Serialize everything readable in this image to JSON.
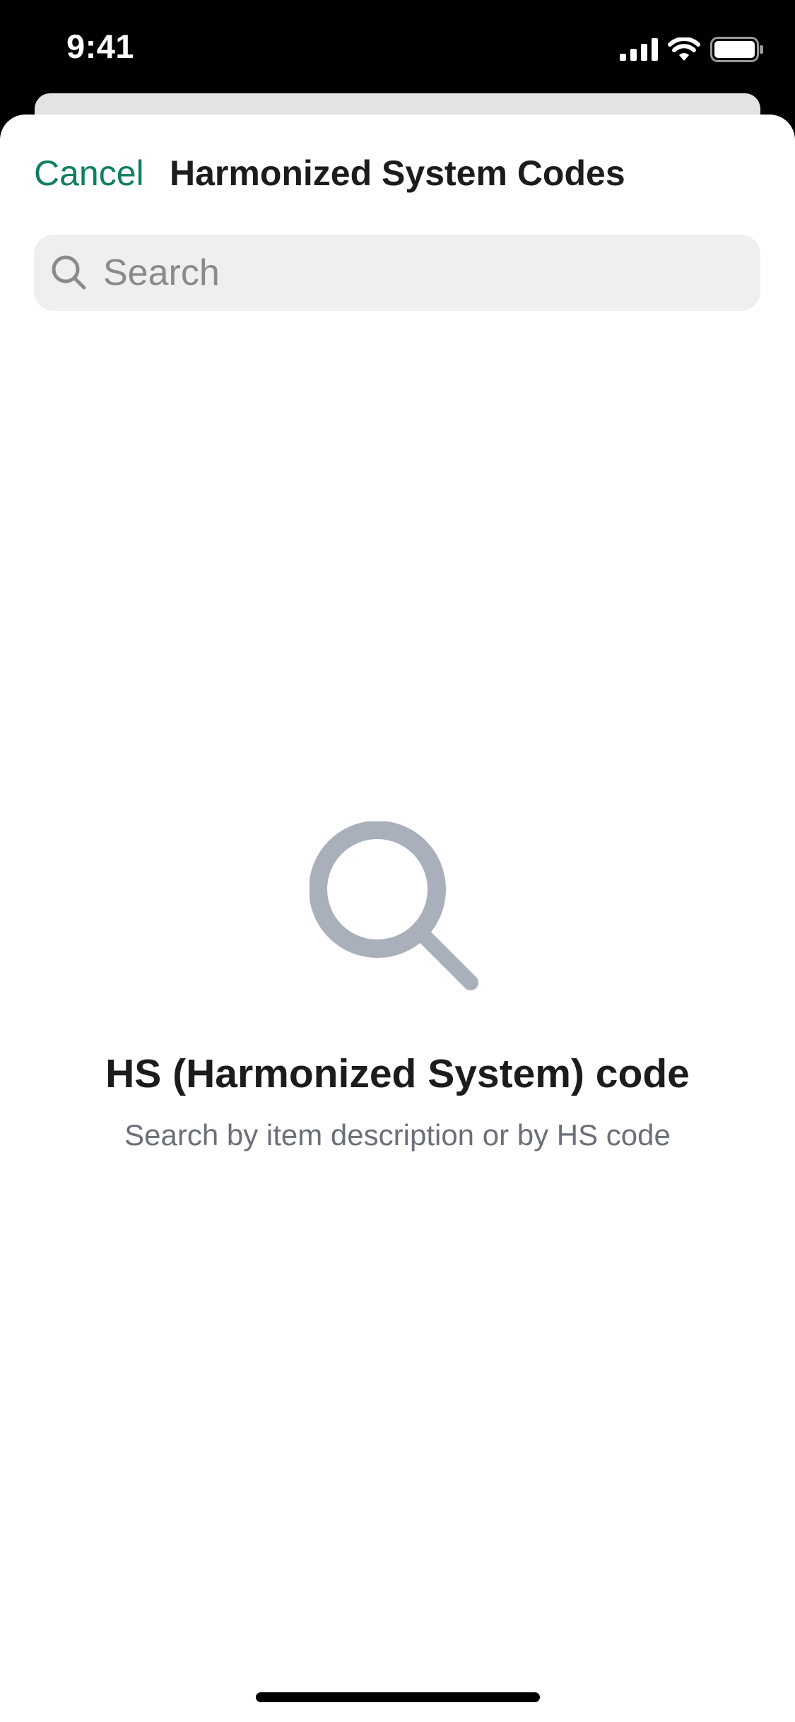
{
  "status_bar": {
    "time": "9:41",
    "icons": [
      "cellular-signal-icon",
      "wifi-icon",
      "battery-icon"
    ]
  },
  "nav": {
    "cancel_label": "Cancel",
    "title": "Harmonized System Codes"
  },
  "search": {
    "placeholder": "Search",
    "value": ""
  },
  "empty_state": {
    "icon": "search-icon",
    "title": "HS (Harmonized System) code",
    "subtitle": "Search by item description or by HS code"
  },
  "colors": {
    "accent": "#107e62",
    "search_background": "#efefef",
    "empty_icon": "#a9b0bb",
    "title_text": "#1c1c1e",
    "subtitle_text": "#6b6f78"
  }
}
